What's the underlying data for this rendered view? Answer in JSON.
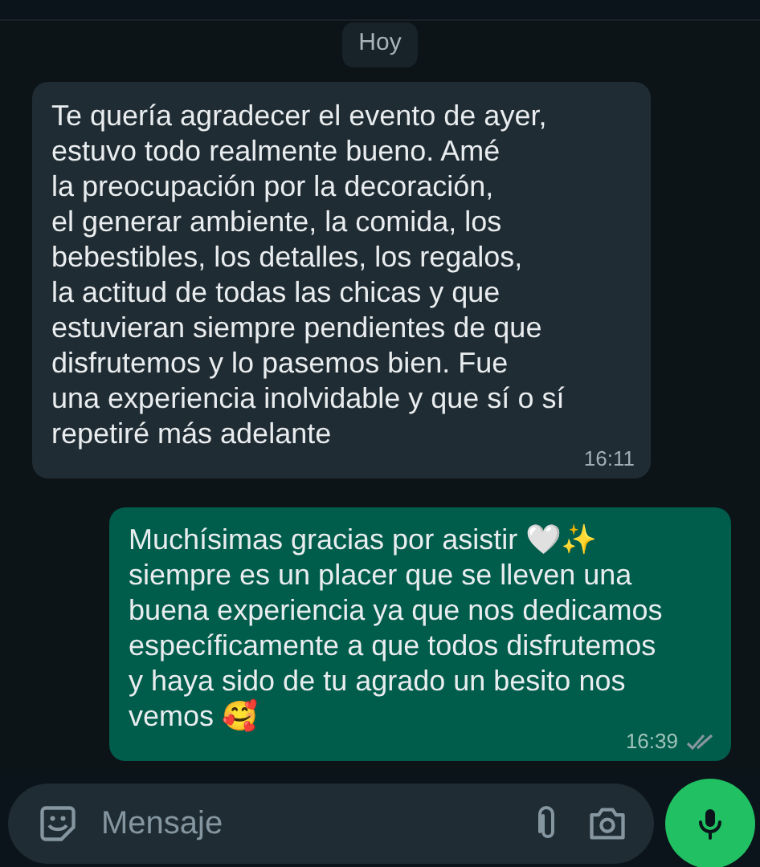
{
  "date_chip": "Hoy",
  "messages": [
    {
      "outgoing": false,
      "lines": [
        "Te quería agradecer el evento de ayer,",
        "estuvo todo realmente bueno. Amé",
        "la preocupación por la decoración,",
        "el generar ambiente, la comida, los",
        "bebestibles, los detalles, los regalos,",
        "la actitud de todas las chicas y que",
        "estuvieran siempre pendientes de que",
        "disfrutemos y lo pasemos bien. Fue",
        "una experiencia inolvidable y que sí o sí",
        "repetiré más adelante"
      ],
      "time": "16:11"
    },
    {
      "outgoing": true,
      "lines": [
        "Muchísimas gracias por asistir 🤍✨",
        "siempre es un placer que se lleven una",
        "buena experiencia ya que nos dedicamos",
        "específicamente a que todos disfrutemos",
        "y haya sido de tu agrado un besito nos",
        "vemos 🥰"
      ],
      "time": "16:39",
      "read": false
    }
  ],
  "composer": {
    "placeholder": "Mensaje"
  }
}
